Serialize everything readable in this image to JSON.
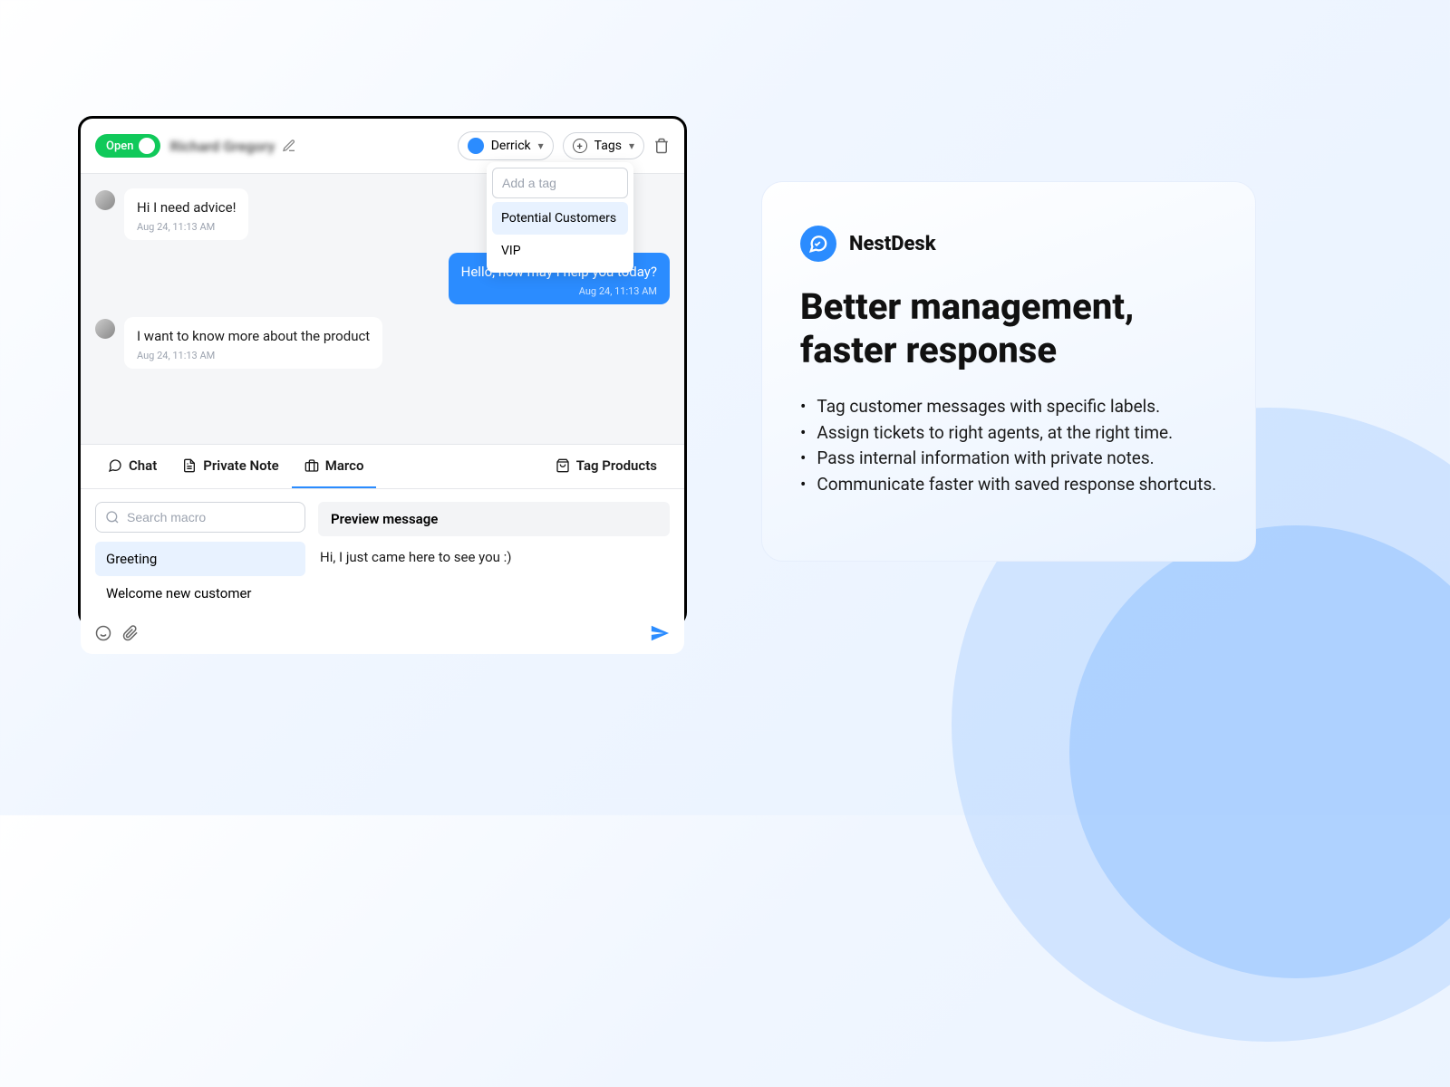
{
  "header": {
    "toggle_label": "Open",
    "customer_name": "Richard Gregory",
    "assignee": "Derrick",
    "tags_label": "Tags"
  },
  "tags_dropdown": {
    "placeholder": "Add a tag",
    "options": [
      "Potential Customers",
      "VIP"
    ]
  },
  "messages": [
    {
      "from": "them",
      "text": "Hi I need advice!",
      "time": "Aug 24, 11:13 AM"
    },
    {
      "from": "me",
      "text": "Hello, how may I help you today?",
      "time": "Aug 24, 11:13 AM"
    },
    {
      "from": "them",
      "text": "I want to know more about the product",
      "time": "Aug 24, 11:13 AM"
    }
  ],
  "composer": {
    "tabs": {
      "chat": "Chat",
      "note": "Private Note",
      "macro": "Marco",
      "tag_products": "Tag Products"
    },
    "search_placeholder": "Search macro",
    "macros": [
      "Greeting",
      "Welcome new customer"
    ],
    "preview_label": "Preview message",
    "preview_body": "Hi, I just came here to see you :)"
  },
  "promo": {
    "brand": "NestDesk",
    "headline": "Better management, faster response",
    "features": [
      "Tag customer messages with specific labels.",
      "Assign tickets to right agents, at the right time.",
      "Pass internal information with private notes.",
      "Communicate faster with saved response shortcuts."
    ]
  }
}
